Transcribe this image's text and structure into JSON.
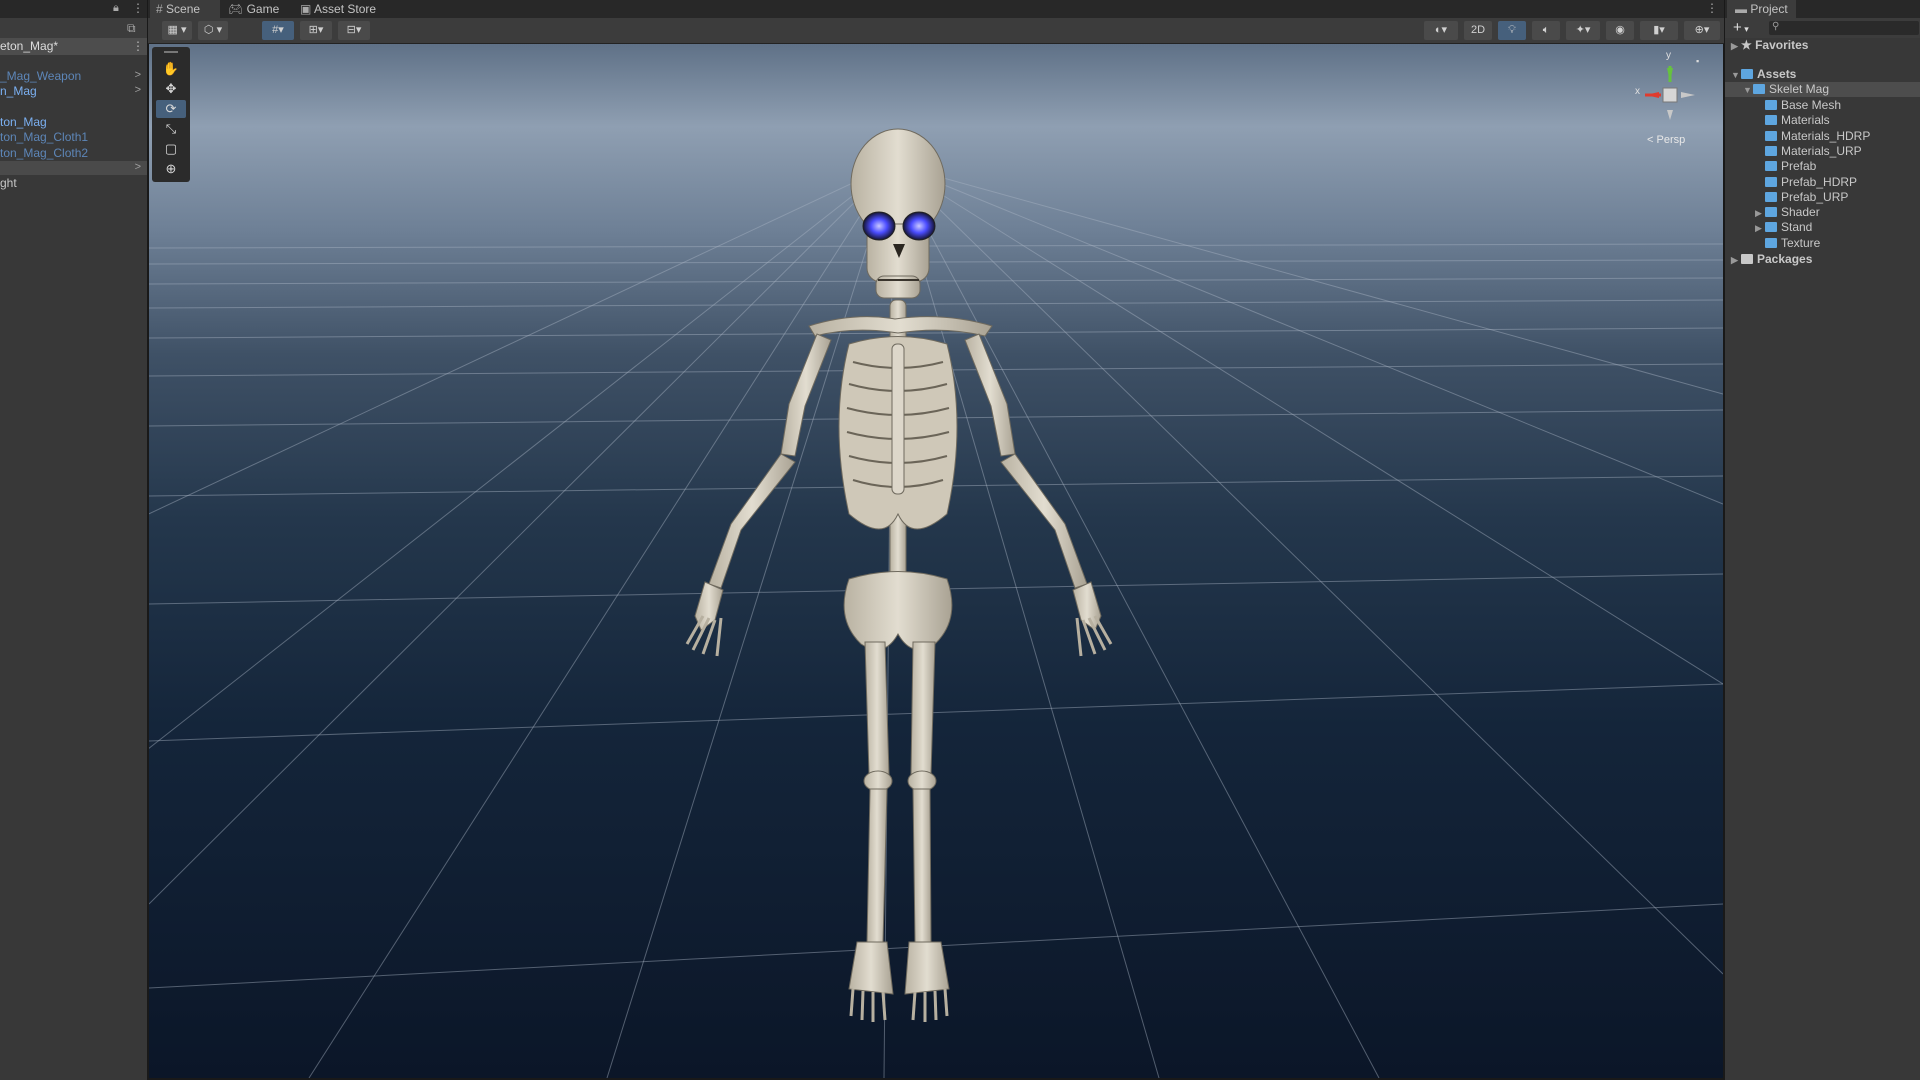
{
  "hierarchy": {
    "scene_name": "eton_Mag*",
    "items": [
      {
        "label": "_Mag_Weapon",
        "style": "dim",
        "chevron": ">"
      },
      {
        "label": "n_Mag",
        "style": "blue",
        "chevron": ">"
      },
      {
        "label": "",
        "style": "plain",
        "chevron": ""
      },
      {
        "label": "ton_Mag",
        "style": "blue",
        "chevron": ""
      },
      {
        "label": "ton_Mag_Cloth1",
        "style": "dim",
        "chevron": ""
      },
      {
        "label": "ton_Mag_Cloth2",
        "style": "dim",
        "chevron": ""
      },
      {
        "label": "",
        "style": "plain",
        "chevron": ">"
      },
      {
        "label": "ght",
        "style": "plain",
        "chevron": ""
      }
    ]
  },
  "scene_tabs": [
    {
      "label": "Scene",
      "icon": "grid-icon"
    },
    {
      "label": "Game",
      "icon": "gamepad-icon"
    },
    {
      "label": "Asset Store",
      "icon": "bag-icon"
    }
  ],
  "toolbar": {
    "two_d_label": "2D"
  },
  "gizmo": {
    "y_label": "y",
    "x_label": "x",
    "projection_label": "Persp"
  },
  "tools": [
    {
      "name": "hand-tool",
      "icon": "hand-icon",
      "glyph": "✋"
    },
    {
      "name": "move-tool",
      "icon": "move-icon",
      "glyph": "✥"
    },
    {
      "name": "rotate-tool",
      "icon": "rotate-icon",
      "glyph": "⟳"
    },
    {
      "name": "scale-tool",
      "icon": "scale-icon",
      "glyph": "⤡"
    },
    {
      "name": "rect-tool",
      "icon": "rect-icon",
      "glyph": "▢"
    },
    {
      "name": "transform-tool",
      "icon": "transform-icon",
      "glyph": "⊕"
    }
  ],
  "project": {
    "tab_label": "Project",
    "add_label": "+",
    "favorites_label": "Favorites",
    "assets_label": "Assets",
    "root_folder": "Skelet Mag",
    "folders": [
      {
        "label": "Base Mesh",
        "expandable": false
      },
      {
        "label": "Materials",
        "expandable": false
      },
      {
        "label": "Materials_HDRP",
        "expandable": false
      },
      {
        "label": "Materials_URP",
        "expandable": false
      },
      {
        "label": "Prefab",
        "expandable": false
      },
      {
        "label": "Prefab_HDRP",
        "expandable": false
      },
      {
        "label": "Prefab_URP",
        "expandable": false
      },
      {
        "label": "Shader",
        "expandable": true
      },
      {
        "label": "Stand",
        "expandable": true
      },
      {
        "label": "Texture",
        "expandable": false
      }
    ],
    "packages_label": "Packages"
  },
  "colors": {
    "accent": "#46607c",
    "folder_blue": "#5ea6e0",
    "link_blue": "#7bb0f2",
    "bone": "#d8d2c4",
    "eye_glow": "#4a4cff"
  }
}
